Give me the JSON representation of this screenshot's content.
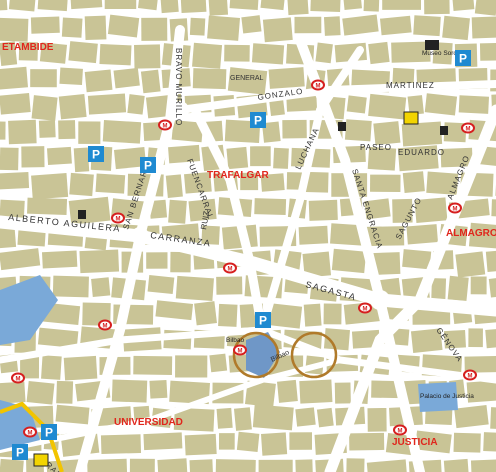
{
  "map": {
    "colors": {
      "block": "#c9c496",
      "street": "#ffffff",
      "park": "#7aa9d8",
      "plaza": "#6f97c7",
      "district_label": "#e0261c",
      "parking": "#1f8ad1",
      "metro": "#d61f1f",
      "street_text": "#333333",
      "circle": "#b07a2a"
    },
    "districts": [
      {
        "id": "trafalgar",
        "name": "TRAFALGAR"
      },
      {
        "id": "almagro",
        "name": "ALMAGRO"
      },
      {
        "id": "universidad",
        "name": "UNIVERSIDAD"
      },
      {
        "id": "justicia",
        "name": "JUSTICIA"
      },
      {
        "id": "chamberi",
        "name": "ETAMBIDE"
      }
    ],
    "streets": [
      {
        "id": "alberto-aguilera",
        "name": "ALBERTO AGUILERA"
      },
      {
        "id": "carranza",
        "name": "CARRANZA"
      },
      {
        "id": "sagasta",
        "name": "SAGASTA"
      },
      {
        "id": "bravo-murillo",
        "name": "BRAVO MURILLO"
      },
      {
        "id": "fuencarral",
        "name": "FUENCARRAL"
      },
      {
        "id": "luchana",
        "name": "LUCHANA"
      },
      {
        "id": "santa-engracia",
        "name": "SANTA ENGRACIA"
      },
      {
        "id": "gonzalo",
        "name": "GONZALO"
      },
      {
        "id": "eduardo-dato",
        "name": "EDUARDO"
      },
      {
        "id": "paseo",
        "name": "PASEO"
      },
      {
        "id": "martinez",
        "name": "MARTINEZ"
      },
      {
        "id": "general",
        "name": "GENERAL"
      },
      {
        "id": "san-bernardo",
        "name": "SAN BERNARDO"
      },
      {
        "id": "ruiz-jimenez",
        "name": "RUIZ"
      },
      {
        "id": "bilbao",
        "name": "Bilbao"
      },
      {
        "id": "sagunto",
        "name": "SAGUNTO"
      },
      {
        "id": "almagro-st",
        "name": "ALMAGRO"
      },
      {
        "id": "genova",
        "name": "GÉNOVA"
      },
      {
        "id": "sn-gran-via",
        "name": "GRAN VIA"
      }
    ],
    "places": [
      {
        "id": "museo-sorolla",
        "name": "Museo Sorolla"
      },
      {
        "id": "palacio-justicia",
        "name": "Palacio de Justicia"
      },
      {
        "id": "plaza-bilbao",
        "name": "Bilbao"
      }
    ],
    "metro_label": "M",
    "parking_label": "P"
  }
}
